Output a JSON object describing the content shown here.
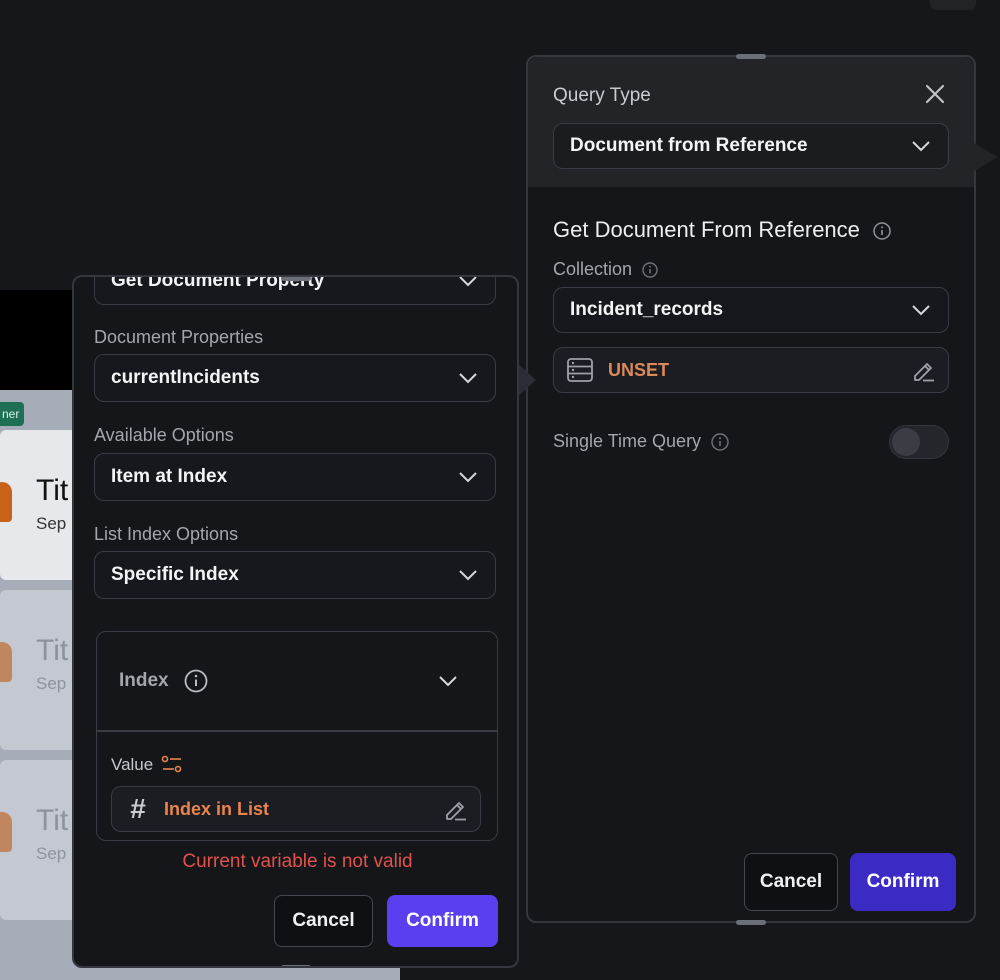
{
  "background": {
    "tag_label": "ner",
    "cards": [
      {
        "title": "Tit",
        "subtitle": "Sep"
      },
      {
        "title": "Tit",
        "subtitle": "Sep"
      },
      {
        "title": "Tit",
        "subtitle": "Sep"
      }
    ]
  },
  "left_panel": {
    "top_select_value": "Get Document Property",
    "document_properties": {
      "label": "Document Properties",
      "value": "currentIncidents"
    },
    "available_options": {
      "label": "Available Options",
      "value": "Item at Index"
    },
    "list_index_options": {
      "label": "List Index Options",
      "value": "Specific Index"
    },
    "index": {
      "label": "Index",
      "value_label": "Value",
      "field_value": "Index in List"
    },
    "error_text": "Current variable is not valid",
    "cancel_label": "Cancel",
    "confirm_label": "Confirm"
  },
  "right_panel": {
    "query_type_label": "Query Type",
    "query_type_value": "Document from Reference",
    "section_title": "Get Document From Reference",
    "collection": {
      "label": "Collection",
      "value": "Incident_records"
    },
    "reference_value": "UNSET",
    "single_time_query": {
      "label": "Single Time Query",
      "enabled": false
    },
    "cancel_label": "Cancel",
    "confirm_label": "Confirm"
  },
  "colors": {
    "accent": "#5a3ff0",
    "error": "#e0524b",
    "variable_orange": "#e9844d",
    "unset_orange": "#d9895a"
  }
}
